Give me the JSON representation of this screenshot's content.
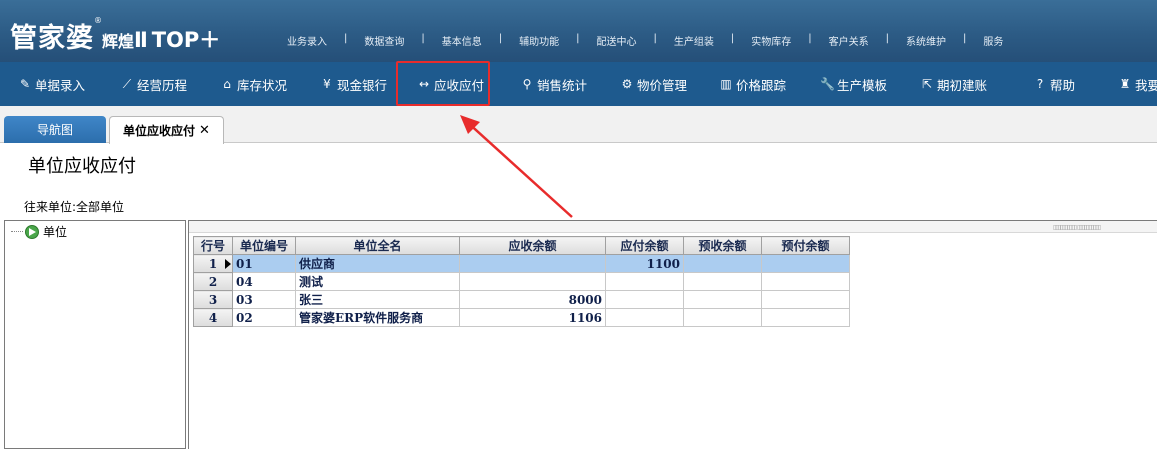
{
  "logo": {
    "main": "管家婆",
    "reg": "®",
    "sub": "辉煌",
    "roman": "Ⅱ",
    "top": "TOP＋"
  },
  "top_menu": [
    "业务录入",
    "数据查询",
    "基本信息",
    "辅助功能",
    "配送中心",
    "生产组装",
    "实物库存",
    "客户关系",
    "系统维护",
    "服务"
  ],
  "top_menu_sep": "|",
  "toolbar": [
    {
      "icon": "document-edit-icon",
      "glyph": "✎",
      "label": "单据录入"
    },
    {
      "icon": "line-chart-icon",
      "glyph": "⟋",
      "label": "经营历程"
    },
    {
      "icon": "home-icon",
      "glyph": "⌂",
      "label": "库存状况"
    },
    {
      "icon": "yen-icon",
      "glyph": "¥",
      "label": "现金银行"
    },
    {
      "icon": "exchange-arrows-icon",
      "glyph": "↔",
      "label": "应收应付"
    },
    {
      "icon": "search-icon",
      "glyph": "⚲",
      "label": "销售统计"
    },
    {
      "icon": "gear-icon",
      "glyph": "⚙",
      "label": "物价管理"
    },
    {
      "icon": "bar-chart-icon",
      "glyph": "▥",
      "label": "价格跟踪"
    },
    {
      "icon": "wrench-icon",
      "glyph": "🔧",
      "label": "生产模板"
    },
    {
      "icon": "external-link-icon",
      "glyph": "⇱",
      "label": "期初建账"
    },
    {
      "icon": "help-icon",
      "glyph": "?",
      "label": "帮助"
    },
    {
      "icon": "money-bag-icon",
      "glyph": "♜",
      "label": "我要"
    }
  ],
  "highlight_color": "#e82c2c",
  "tabs": {
    "nav": "导航图",
    "active": "单位应收应付",
    "close": "✕"
  },
  "page_title": "单位应收应付",
  "filter": {
    "label": "往来单位:",
    "value": "全部单位"
  },
  "tree": {
    "root": "单位"
  },
  "grid": {
    "columns": [
      "行号",
      "单位编号",
      "单位全名",
      "应收余额",
      "应付余额",
      "预收余额",
      "预付余额"
    ],
    "rows": [
      {
        "rn": "1",
        "code": "01",
        "name": "供应商",
        "recv": "",
        "pay": "1100",
        "prerecv": "",
        "prepay": ""
      },
      {
        "rn": "2",
        "code": "04",
        "name": "测试",
        "recv": "",
        "pay": "",
        "prerecv": "",
        "prepay": ""
      },
      {
        "rn": "3",
        "code": "03",
        "name": "张三",
        "recv": "8000",
        "pay": "",
        "prerecv": "",
        "prepay": ""
      },
      {
        "rn": "4",
        "code": "02",
        "name": "管家婆ERP软件服务商",
        "recv": "1106",
        "pay": "",
        "prerecv": "",
        "prepay": ""
      }
    ],
    "selected_row": 1,
    "selection_color": "#abcdf0"
  },
  "splitter_grip": "▯▯▯▯▯▯▯▯▯▯ ▯▯▯▯▯▯▯▯▯▯"
}
